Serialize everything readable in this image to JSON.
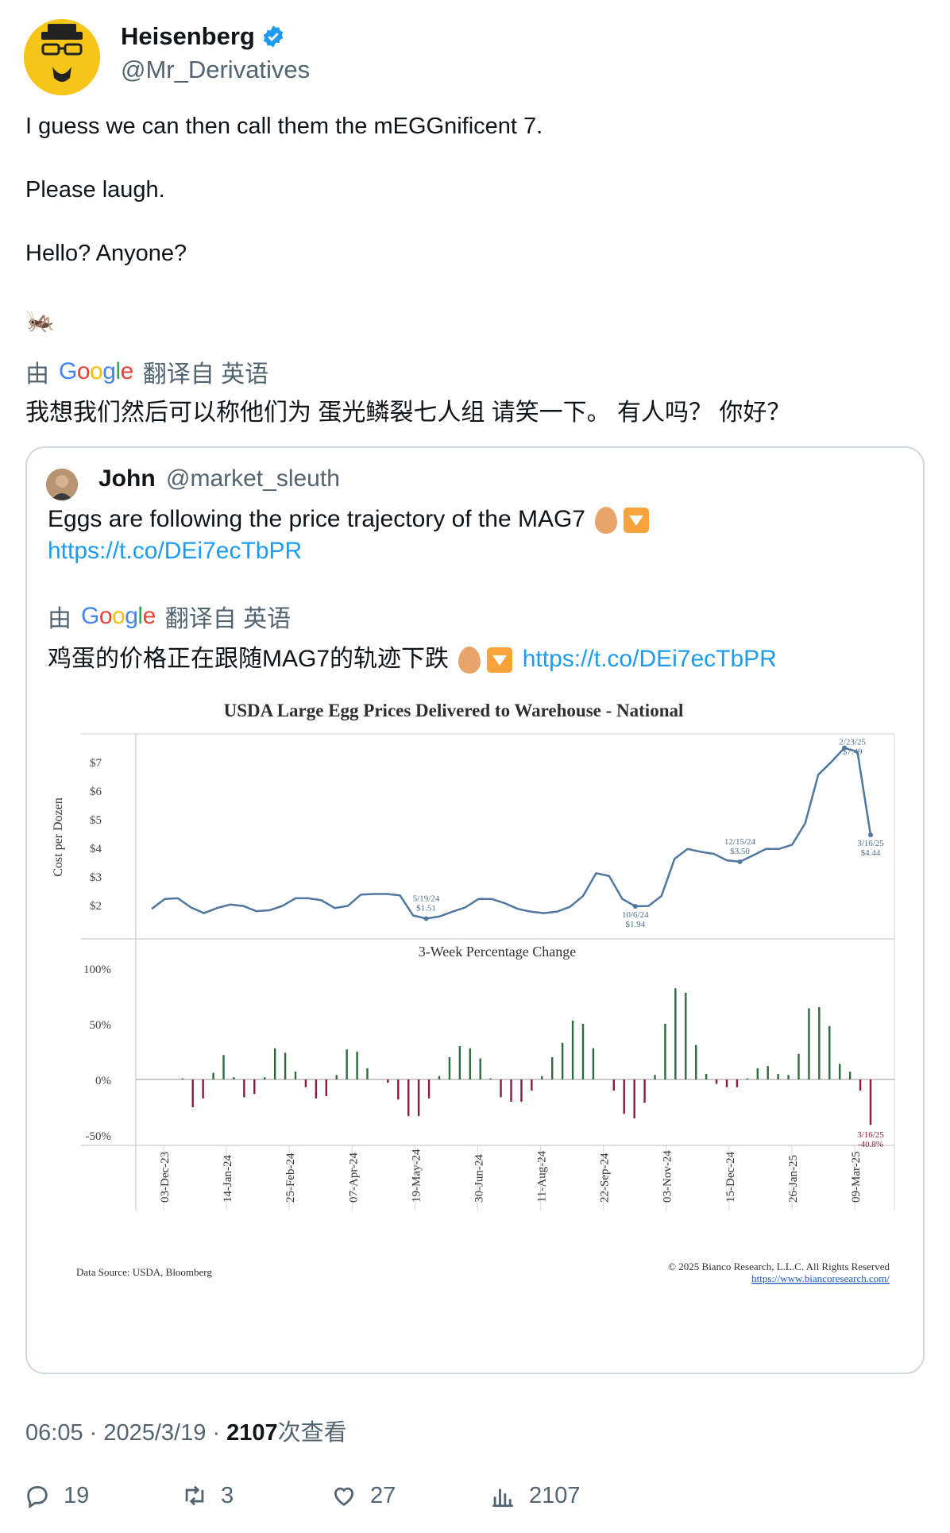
{
  "author": {
    "name": "Heisenberg",
    "handle": "@Mr_Derivatives"
  },
  "tweet": {
    "line1": "I guess we can then call them the  mEGGnificent 7.",
    "line2": "Please laugh.",
    "line3": "Hello? Anyone?",
    "emoji": "🦗"
  },
  "translation": {
    "prefix": "由",
    "google": [
      "G",
      "o",
      "o",
      "g",
      "l",
      "e"
    ],
    "suffix": "翻译自 英语",
    "text": "我想我们然后可以称他们为 蛋光鳞裂七人组 请笑一下。 有人吗？ 你好？"
  },
  "quote": {
    "name": "John",
    "handle": "@market_sleuth",
    "text": "Eggs are following the price trajectory of the MAG7",
    "link": "https://t.co/DEi7ecTbPR",
    "translation_prefix": "由",
    "translation_suffix": "翻译自 英语",
    "translated_text": "鸡蛋的价格正在跟随MAG7的轨迹下跌",
    "translated_link": "https://t.co/DEi7ecTbPR"
  },
  "chart_data": {
    "type": "line",
    "title": "USDA Large Egg Prices  Delivered to Warehouse - National",
    "ylabel": "Cost per Dozen",
    "yticks": [
      "$7",
      "$6",
      "$5",
      "$4",
      "$3",
      "$2"
    ],
    "ylim": [
      1.3,
      7.7
    ],
    "xlabels": [
      "03-Dec-23",
      "14-Jan-24",
      "25-Feb-24",
      "07-Apr-24",
      "19-May-24",
      "30-Jun-24",
      "11-Aug-24",
      "22-Sep-24",
      "03-Nov-24",
      "15-Dec-24",
      "26-Jan-25",
      "09-Mar-25"
    ],
    "series": [
      {
        "values": [
          1.85,
          2.2,
          2.22,
          1.9,
          1.7,
          1.88,
          2.0,
          1.95,
          1.77,
          1.8,
          1.95,
          2.22,
          2.22,
          2.15,
          1.88,
          1.95,
          2.35,
          2.37,
          2.37,
          2.32,
          1.62,
          1.51,
          1.58,
          1.75,
          1.9,
          2.2,
          2.2,
          2.05,
          1.85,
          1.75,
          1.7,
          1.75,
          1.92,
          2.3,
          3.1,
          3.0,
          2.2,
          1.94,
          1.95,
          2.3,
          3.6,
          3.95,
          3.85,
          3.78,
          3.55,
          3.5,
          3.72,
          3.95,
          3.95,
          4.1,
          4.85,
          6.55,
          7.0,
          7.49,
          7.35,
          4.44
        ]
      }
    ],
    "annotations": [
      {
        "date": "5/19/24",
        "value": "$1.51"
      },
      {
        "date": "10/6/24",
        "value": "$1.94"
      },
      {
        "date": "12/15/24",
        "value": "$3.50"
      },
      {
        "date": "2/23/25",
        "value": "$7.49"
      },
      {
        "date": "3/16/25",
        "value": "$4.44"
      }
    ],
    "lower": {
      "type": "bar",
      "title": "3-Week Percentage Change",
      "yticks": [
        "100%",
        "50%",
        "0%",
        "-50%"
      ],
      "ylim": [
        -60,
        100
      ],
      "values": [
        0,
        0,
        0,
        1,
        -25,
        -17,
        6,
        22,
        2,
        -16,
        -13,
        2,
        28,
        24,
        7,
        -7,
        -17,
        -15,
        4,
        27,
        25,
        10,
        0,
        -3,
        -18,
        -33,
        -33,
        -17,
        3,
        20,
        30,
        28,
        19,
        1,
        -16,
        -20,
        -20,
        -10,
        3,
        20,
        33,
        53,
        50,
        28,
        0,
        -10,
        -31,
        -35,
        -21,
        4,
        50,
        82,
        78,
        31,
        5,
        -4,
        -7,
        -7,
        1,
        10,
        12,
        5,
        4,
        23,
        64,
        65,
        48,
        14,
        7,
        -10,
        -40.8
      ],
      "annotation": {
        "date": "3/16/25",
        "value": "-40.8%"
      }
    },
    "source": "Data Source: USDA, Bloomberg",
    "copyright": "© 2025 Bianco Research, L.L.C. All Rights Reserved",
    "url": "https://www.biancoresearch.com/"
  },
  "meta": {
    "time": "06:05",
    "date": "2025/3/19",
    "views": "2107",
    "views_suffix": "次查看"
  },
  "actions": {
    "reply": "19",
    "retweet": "3",
    "like": "27",
    "views": "2107"
  },
  "colors": {
    "line": "#4f77a0",
    "positive": "#2e6b3c",
    "negative": "#8b1a3e",
    "link": "#1d9bf0",
    "verified": "#1d9bf0"
  }
}
